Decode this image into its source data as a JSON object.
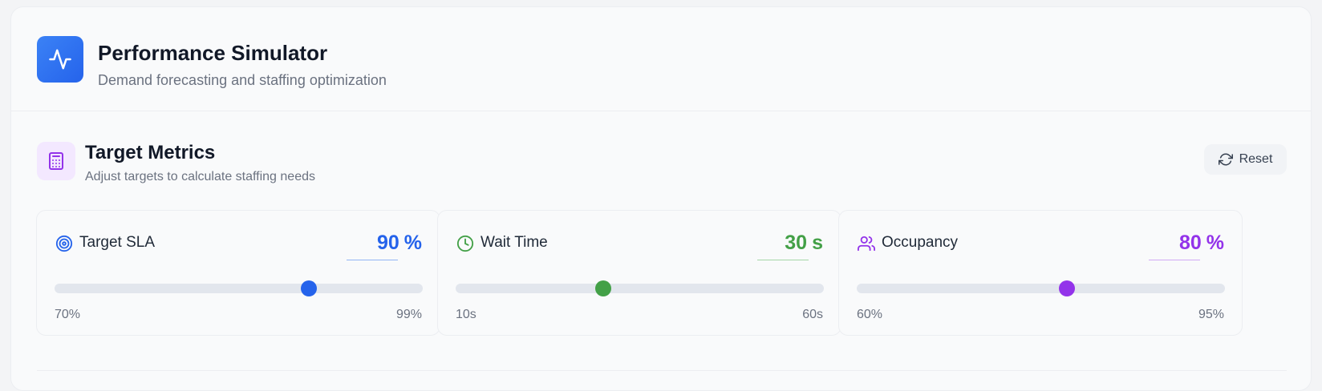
{
  "header": {
    "title": "Performance Simulator",
    "subtitle": "Demand forecasting and staffing optimization",
    "icon": "activity-pulse-icon"
  },
  "section": {
    "title": "Target Metrics",
    "subtitle": "Adjust targets to calculate staffing needs",
    "icon": "calculator-icon",
    "reset_label": "Reset",
    "reset_icon": "refresh-icon"
  },
  "metrics": [
    {
      "label": "Target SLA",
      "icon": "target-icon",
      "value": "90",
      "unit": "%",
      "min_label": "70%",
      "max_label": "99%",
      "min": 70,
      "max": 99,
      "current": 90,
      "color": "#2563eb"
    },
    {
      "label": "Wait Time",
      "icon": "clock-icon",
      "value": "30",
      "unit": "s",
      "min_label": "10s",
      "max_label": "60s",
      "min": 10,
      "max": 60,
      "current": 30,
      "color": "#43a047"
    },
    {
      "label": "Occupancy",
      "icon": "users-icon",
      "value": "80",
      "unit": "%",
      "min_label": "60%",
      "max_label": "95%",
      "min": 60,
      "max": 95,
      "current": 80,
      "color": "#9333ea"
    }
  ]
}
